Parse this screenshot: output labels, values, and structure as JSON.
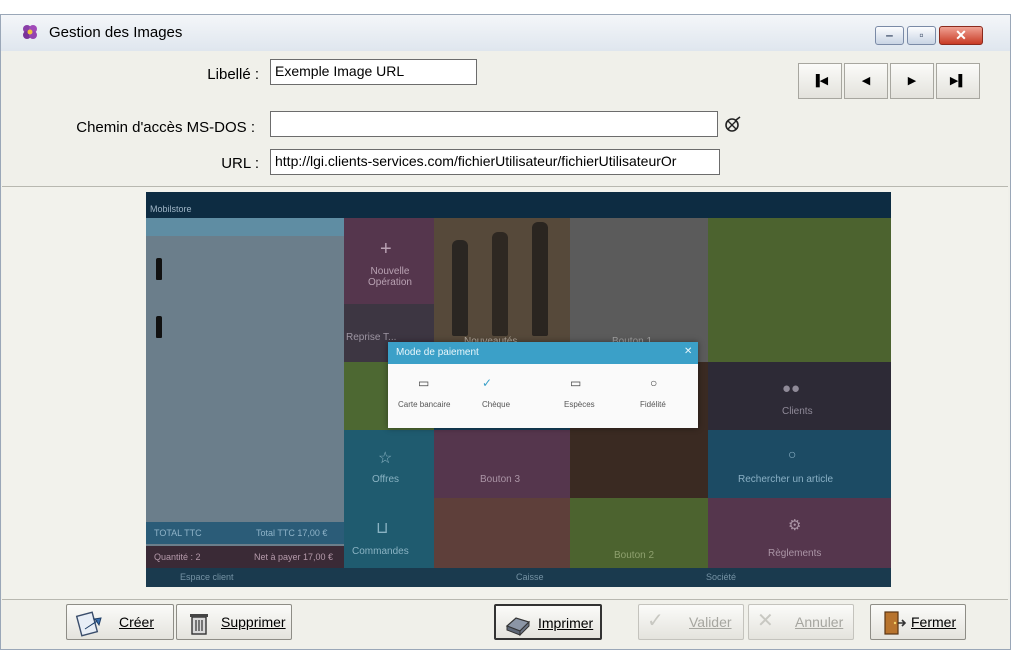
{
  "window": {
    "title": "Gestion des Images"
  },
  "form": {
    "libelle_label": "Libellé :",
    "libelle_value": "Exemple Image URL",
    "path_label": "Chemin d'accès MS-DOS :",
    "path_value": "",
    "url_label": "URL :",
    "url_value": "http://lgi.clients-services.com/fichierUtilisateur/fichierUtilisateurOr"
  },
  "preview": {
    "app_title": "Mobilstore",
    "tiles": {
      "nouvelle_operation": "Nouvelle Opération",
      "reprise": "Reprise T...",
      "nouveautes": "Nouveautés",
      "bouton1": "Bouton 1",
      "offres": "Offres",
      "bouton3": "Bouton 3",
      "clients": "Clients",
      "rechercher": "Rechercher un article",
      "commandes": "Commandes",
      "bouton2": "Bouton 2",
      "reglements": "Règlements"
    },
    "dialog": {
      "title": "Mode de paiement",
      "options": [
        "Carte bancaire",
        "Chèque",
        "Espèces",
        "Fidélité"
      ]
    },
    "left_footer": {
      "label1": "TOTAL TTC",
      "value1": "Total TTC 17,00 €",
      "label2": "Quantité : 2",
      "value2": "Net à payer 17,00 €"
    },
    "bottom_bar": [
      "Espace client",
      "Caisse",
      "Société"
    ]
  },
  "buttons": {
    "creer": "Créer",
    "supprimer": "Supprimer",
    "imprimer": "Imprimer",
    "valider": "Valider",
    "annuler": "Annuler",
    "fermer": "Fermer"
  },
  "colors": {
    "panel_bg": "#f0f0ea",
    "preview_dark": "#143f5b",
    "tile_green": "#6f8f3a",
    "tile_teal": "#2e7f97",
    "tile_purple": "#6d3f63",
    "dialog_header": "#3ba0c8"
  }
}
